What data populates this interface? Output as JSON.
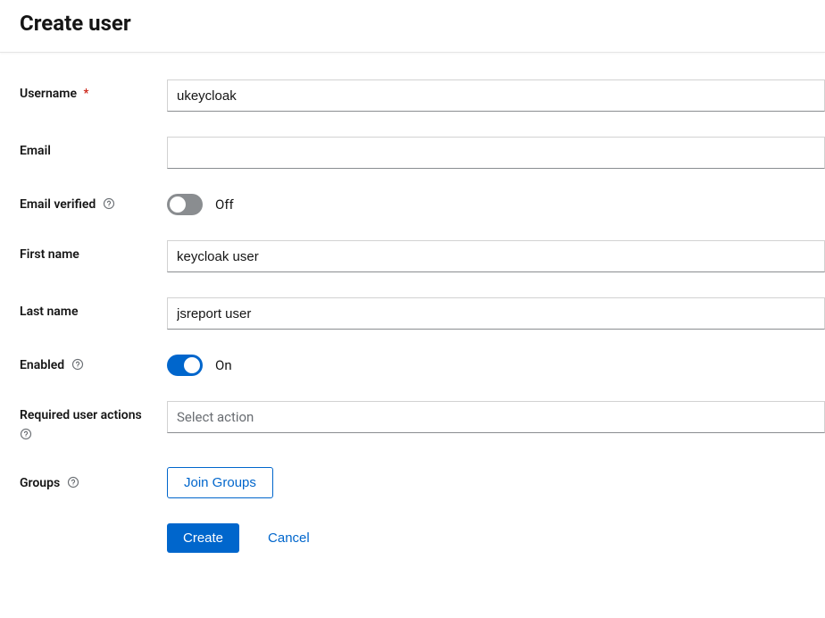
{
  "header": {
    "title": "Create user"
  },
  "form": {
    "username": {
      "label": "Username",
      "required_marker": "*",
      "value": "ukeycloak"
    },
    "email": {
      "label": "Email",
      "value": ""
    },
    "email_verified": {
      "label": "Email verified",
      "state_text": "Off"
    },
    "first_name": {
      "label": "First name",
      "value": "keycloak user"
    },
    "last_name": {
      "label": "Last name",
      "value": "jsreport user"
    },
    "enabled": {
      "label": "Enabled",
      "state_text": "On"
    },
    "required_actions": {
      "label": "Required user actions",
      "placeholder": "Select action"
    },
    "groups": {
      "label": "Groups",
      "join_button": "Join Groups"
    }
  },
  "actions": {
    "create": "Create",
    "cancel": "Cancel"
  }
}
